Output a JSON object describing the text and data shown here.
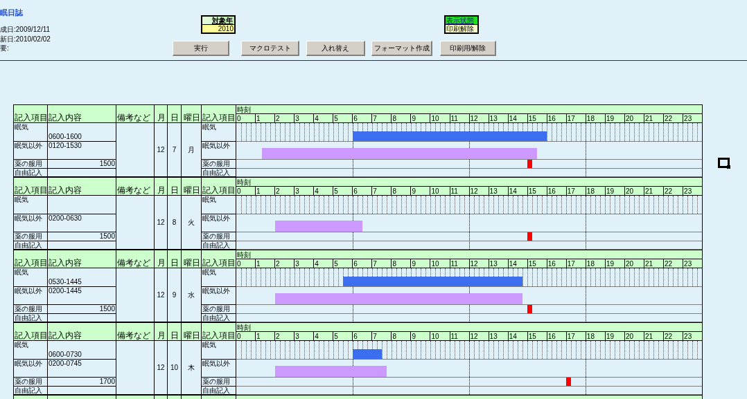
{
  "title": "眠日誌",
  "meta": [
    "成日:2009/12/11",
    "新日:2010/02/02",
    "要:"
  ],
  "target_year": {
    "label": "対象年",
    "value": "2010"
  },
  "display_state": {
    "label": "表示状態",
    "value": "印刷解除"
  },
  "buttons": [
    "実行",
    "マクロテスト",
    "入れ替え",
    "フォーマット作成",
    "印刷用/解除"
  ],
  "days": [
    {
      "headers": [
        "記入項目",
        "記入内容",
        "備考など",
        "月",
        "日",
        "曜日",
        "記入項目"
      ],
      "time_label": "時刻",
      "hours": [
        "0",
        "1",
        "2",
        "3",
        "4",
        "5",
        "6",
        "7",
        "8",
        "9",
        "10",
        "11",
        "12",
        "13",
        "14",
        "15",
        "16",
        "17",
        "18",
        "19",
        "20",
        "21",
        "22",
        "23"
      ],
      "month": "12",
      "day": "7",
      "weekday": "月",
      "rows": [
        {
          "kind": "sleep",
          "label": "眠気",
          "content": "0600-1600",
          "right_label": "眠気"
        },
        {
          "kind": "other",
          "label": "眠気以外",
          "content": "0120-1530",
          "right_label": "眠気以外"
        },
        {
          "kind": "medicine",
          "label": "薬の服用",
          "content": "1500",
          "right_label": "薬の服用"
        },
        {
          "kind": "free",
          "label": "自由記入",
          "content": "",
          "right_label": "自由記入"
        }
      ]
    },
    {
      "headers": [
        "記入項目",
        "記入内容",
        "備考など",
        "月",
        "日",
        "曜日",
        "記入項目"
      ],
      "time_label": "時刻",
      "hours": [
        "0",
        "1",
        "2",
        "3",
        "4",
        "5",
        "6",
        "7",
        "8",
        "9",
        "10",
        "11",
        "12",
        "13",
        "14",
        "15",
        "16",
        "17",
        "18",
        "19",
        "20",
        "21",
        "22",
        "23"
      ],
      "month": "12",
      "day": "8",
      "weekday": "火",
      "rows": [
        {
          "kind": "sleep",
          "label": "眠気",
          "content": "",
          "right_label": "眠気"
        },
        {
          "kind": "other",
          "label": "眠気以外",
          "content": "0200-0630",
          "right_label": "眠気以外"
        },
        {
          "kind": "medicine",
          "label": "薬の服用",
          "content": "1500",
          "right_label": "薬の服用"
        },
        {
          "kind": "free",
          "label": "自由記入",
          "content": "",
          "right_label": "自由記入"
        }
      ]
    },
    {
      "headers": [
        "記入項目",
        "記入内容",
        "備考など",
        "月",
        "日",
        "曜日",
        "記入項目"
      ],
      "time_label": "時刻",
      "hours": [
        "0",
        "1",
        "2",
        "3",
        "4",
        "5",
        "6",
        "7",
        "8",
        "9",
        "10",
        "11",
        "12",
        "13",
        "14",
        "15",
        "16",
        "17",
        "18",
        "19",
        "20",
        "21",
        "22",
        "23"
      ],
      "month": "12",
      "day": "9",
      "weekday": "水",
      "rows": [
        {
          "kind": "sleep",
          "label": "眠気",
          "content": "0530-1445",
          "right_label": "眠気"
        },
        {
          "kind": "other",
          "label": "眠気以外",
          "content": "0200-1445",
          "right_label": "眠気以外"
        },
        {
          "kind": "medicine",
          "label": "薬の服用",
          "content": "1500",
          "right_label": "薬の服用"
        },
        {
          "kind": "free",
          "label": "自由記入",
          "content": "",
          "right_label": "自由記入"
        }
      ]
    },
    {
      "headers": [
        "記入項目",
        "記入内容",
        "備考など",
        "月",
        "日",
        "曜日",
        "記入項目"
      ],
      "time_label": "時刻",
      "hours": [
        "0",
        "1",
        "2",
        "3",
        "4",
        "5",
        "6",
        "7",
        "8",
        "9",
        "10",
        "11",
        "12",
        "13",
        "14",
        "15",
        "16",
        "17",
        "18",
        "19",
        "20",
        "21",
        "22",
        "23"
      ],
      "month": "12",
      "day": "10",
      "weekday": "木",
      "rows": [
        {
          "kind": "sleep",
          "label": "眠気",
          "content": "0600-0730",
          "right_label": "眠気"
        },
        {
          "kind": "other",
          "label": "眠気以外",
          "content": "0200-0745",
          "right_label": "眠気以外"
        },
        {
          "kind": "medicine",
          "label": "薬の服用",
          "content": "1700",
          "right_label": "薬の服用"
        },
        {
          "kind": "free",
          "label": "自由記入",
          "content": "",
          "right_label": "自由記入"
        }
      ]
    }
  ]
}
